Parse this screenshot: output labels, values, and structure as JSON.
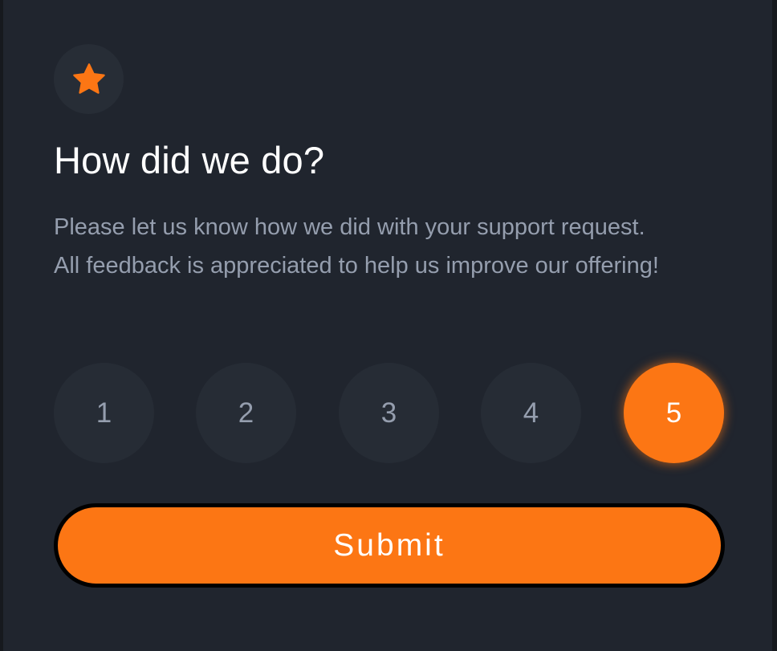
{
  "card": {
    "icon": "star-icon",
    "title": "How did we do?",
    "description": "Please let us know how we did with your support request. All feedback is appreciated to help us improve our offering!",
    "ratings": [
      "1",
      "2",
      "3",
      "4",
      "5"
    ],
    "selected_rating": "5",
    "submit_label": "Submit"
  },
  "colors": {
    "background": "#20252e",
    "accent": "#fc7614",
    "muted_text": "#959eae",
    "circle": "#262c35"
  }
}
